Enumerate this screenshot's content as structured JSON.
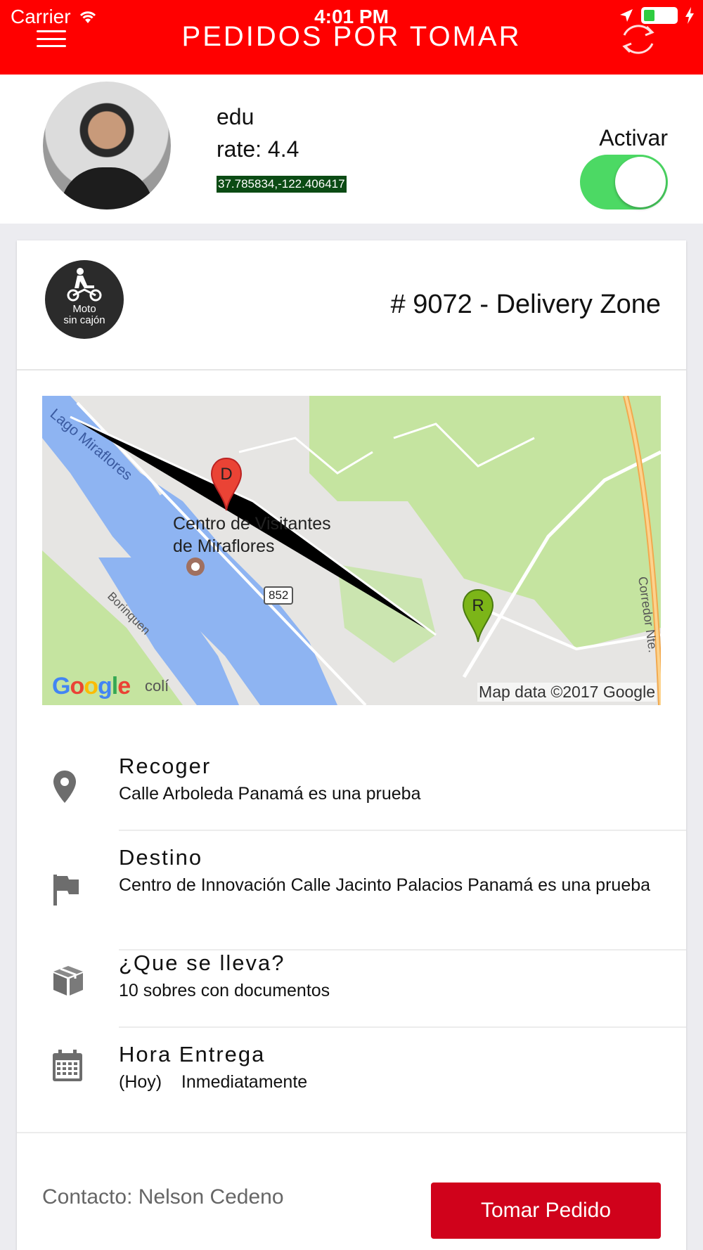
{
  "status_bar": {
    "carrier": "Carrier",
    "time": "4:01 PM",
    "battery_level": 0.35
  },
  "header": {
    "title": "PEDIDOS POR TOMAR",
    "bg_color": "#ff0000"
  },
  "profile": {
    "name": "edu",
    "rate": "rate: 4.4",
    "coords": "37.785834,-122.406417",
    "toggle_label": "Activar",
    "toggle_on": true
  },
  "order": {
    "vehicle_label_line1": "Moto",
    "vehicle_label_line2": "sin cajón",
    "title": "# 9072 - Delivery Zone"
  },
  "map": {
    "place_line1": "Centro de Visitantes",
    "place_line2": "de Miraflores",
    "road_badge": "852",
    "credit": "Map data ©2017 Google",
    "pin_pickup_letter": "R",
    "pin_dest_letter": "D",
    "labels": [
      "Lago Miraflores",
      "Borinquen",
      "Corredor Nte.",
      "colí"
    ]
  },
  "details": [
    {
      "icon": "location-pin-icon",
      "title": "Recoger",
      "value": "Calle Arboleda Panamá es una prueba"
    },
    {
      "icon": "flag-icon",
      "title": "Destino",
      "value": "Centro de Innovación Calle Jacinto Palacios Panamá es una prueba"
    },
    {
      "icon": "package-icon",
      "title": "¿Que se lleva?",
      "value": "10 sobres con documentos"
    },
    {
      "icon": "calendar-icon",
      "title": "Hora Entrega",
      "value_day": "(Hoy)",
      "value_time": "Inmediatamente"
    }
  ],
  "footer": {
    "contact": "Contacto: Nelson Cedeno",
    "button": "Tomar Pedido",
    "button_color": "#d0021b"
  }
}
